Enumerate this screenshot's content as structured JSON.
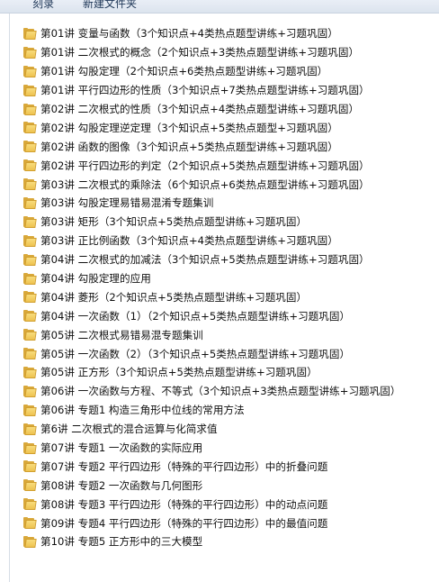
{
  "toolbar": {
    "burn_label": "刻录",
    "new_folder_label": "新建文件夹"
  },
  "files": [
    {
      "name": "第01讲 变量与函数（3个知识点+4类热点题型讲练+习题巩固）"
    },
    {
      "name": "第01讲 二次根式的概念（2个知识点+3类热点题型讲练+习题巩固）"
    },
    {
      "name": "第01讲 勾股定理（2个知识点+6类热点题型讲练+习题巩固）"
    },
    {
      "name": "第01讲 平行四边形的性质（3个知识点+7类热点题型讲练+习题巩固）"
    },
    {
      "name": "第02讲 二次根式的性质（3个知识点+4类热点题型讲练+习题巩固）"
    },
    {
      "name": "第02讲 勾股定理逆定理（3个知识点+5类热点题型+习题巩固）"
    },
    {
      "name": "第02讲 函数的图像（3个知识点+5类热点题型讲练+习题巩固）"
    },
    {
      "name": "第02讲 平行四边形的判定（2个知识点+5类热点题型讲练+习题巩固）"
    },
    {
      "name": "第03讲 二次根式的乘除法（6个知识点+6类热点题型讲练+习题巩固）"
    },
    {
      "name": "第03讲 勾股定理易错易混淆专题集训"
    },
    {
      "name": "第03讲 矩形（3个知识点+5类热点题型讲练+习题巩固）"
    },
    {
      "name": "第03讲 正比例函数（3个知识点+4类热点题型讲练+习题巩固）"
    },
    {
      "name": "第04讲 二次根式的加减法（3个知识点+5类热点题型讲练+习题巩固）"
    },
    {
      "name": "第04讲 勾股定理的应用"
    },
    {
      "name": "第04讲 菱形（2个知识点+5类热点题型讲练+习题巩固）"
    },
    {
      "name": "第04讲 一次函数（1）（2个知识点+5类热点题型讲练+习题巩固）"
    },
    {
      "name": "第05讲  二次根式易错易混专题集训"
    },
    {
      "name": "第05讲 一次函数（2）（3个知识点+5类热点题型讲练+习题巩固）"
    },
    {
      "name": "第05讲 正方形（3个知识点+5类热点题型讲练+习题巩固）"
    },
    {
      "name": "第06讲 一次函数与方程、不等式（3个知识点+3类热点题型讲练+习题巩固）"
    },
    {
      "name": "第06讲 专题1  构造三角形中位线的常用方法"
    },
    {
      "name": "第6讲  二次根式的混合运算与化简求值"
    },
    {
      "name": "第07讲 专题1  一次函数的实际应用"
    },
    {
      "name": "第07讲 专题2  平行四边形（特殊的平行四边形）中的折叠问题"
    },
    {
      "name": "第08讲 专题2  一次函数与几何图形"
    },
    {
      "name": "第08讲 专题3  平行四边形（特殊的平行四边形）中的动点问题"
    },
    {
      "name": "第09讲 专题4  平行四边形（特殊的平行四边形）中的最值问题"
    },
    {
      "name": "第10讲 专题5  正方形中的三大模型"
    }
  ]
}
